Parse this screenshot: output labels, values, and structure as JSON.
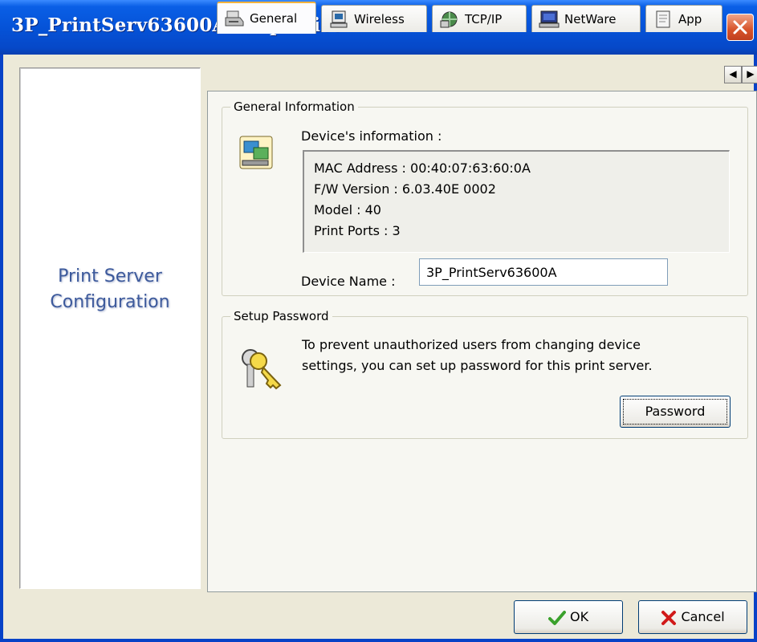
{
  "window": {
    "title": "3P_PrintServ63600A Properties"
  },
  "sidebar": {
    "title_line1": "Print Server",
    "title_line2": "Configuration"
  },
  "tabs": [
    {
      "label": "General",
      "icon": "printer-icon"
    },
    {
      "label": "Wireless",
      "icon": "wireless-icon"
    },
    {
      "label": "TCP/IP",
      "icon": "network-icon"
    },
    {
      "label": "NetWare",
      "icon": "computer-icon"
    },
    {
      "label": "App",
      "icon": "app-icon"
    }
  ],
  "general_info": {
    "legend": "General Information",
    "device_info_label": "Device's information :",
    "mac": "MAC Address : 00:40:07:63:60:0A",
    "fw": "F/W Version : 6.03.40E 0002",
    "model": "Model : 40",
    "ports": "Print Ports : 3",
    "device_name_label": "Device Name :",
    "device_name_value": "3P_PrintServ63600A"
  },
  "setup_password": {
    "legend": "Setup Password",
    "description_line1": "To prevent unauthorized users from changing device",
    "description_line2": "settings, you can set up password for this print server.",
    "button_label": "Password"
  },
  "footer": {
    "ok_label": "OK",
    "cancel_label": "Cancel"
  },
  "colors": {
    "titlebar": "#0553d8",
    "close": "#d7532a",
    "tab_highlight": "#f3b33d",
    "sidebar_text": "#3d5a9c"
  }
}
